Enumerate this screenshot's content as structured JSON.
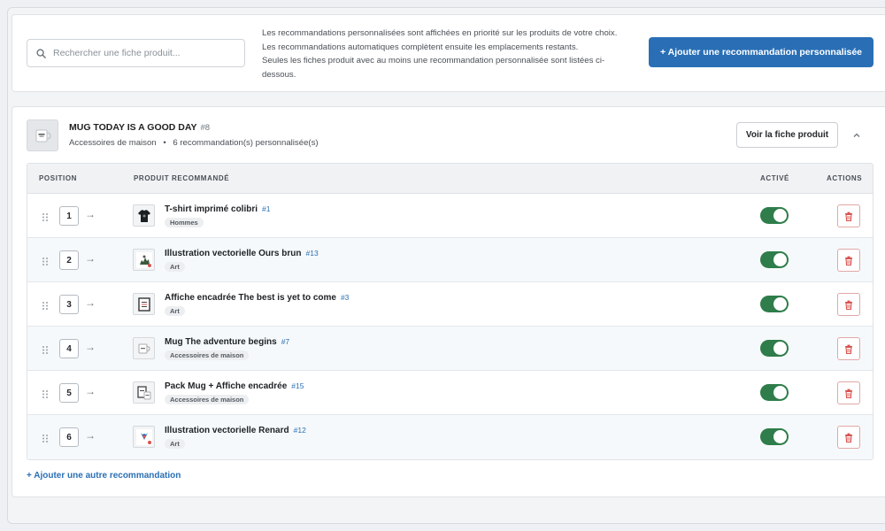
{
  "header": {
    "search_placeholder": "Rechercher une fiche produit...",
    "info_lines": [
      "Les recommandations personnalisées sont affichées en priorité sur les produits de votre choix.",
      "Les recommandations automatiques complètent ensuite les emplacements restants.",
      "Seules les fiches produit avec au moins une recommandation personnalisée sont listées ci-dessous."
    ],
    "add_button": "+ Ajouter une recommandation personnalisée"
  },
  "product": {
    "title": "MUG TODAY IS A GOOD DAY",
    "id": "#8",
    "category": "Accessoires de maison",
    "separator": "•",
    "count_text": "6 recommandation(s) personnalisée(s)",
    "view_button": "Voir la fiche produit"
  },
  "table": {
    "headers": {
      "position": "POSITION",
      "product": "PRODUIT RECOMMANDÉ",
      "active": "ACTIVÉ",
      "actions": "ACTIONS"
    },
    "rows": [
      {
        "position": "1",
        "name": "T-shirt imprimé colibri",
        "id": "#1",
        "category": "Hommes",
        "active": true,
        "thumb": "tshirt"
      },
      {
        "position": "2",
        "name": "Illustration vectorielle Ours brun",
        "id": "#13",
        "category": "Art",
        "active": true,
        "thumb": "bear"
      },
      {
        "position": "3",
        "name": "Affiche encadrée The best is yet to come",
        "id": "#3",
        "category": "Art",
        "active": true,
        "thumb": "frame"
      },
      {
        "position": "4",
        "name": "Mug The adventure begins",
        "id": "#7",
        "category": "Accessoires de maison",
        "active": true,
        "thumb": "mug"
      },
      {
        "position": "5",
        "name": "Pack Mug + Affiche encadrée",
        "id": "#15",
        "category": "Accessoires de maison",
        "active": true,
        "thumb": "pack"
      },
      {
        "position": "6",
        "name": "Illustration vectorielle Renard",
        "id": "#12",
        "category": "Art",
        "active": true,
        "thumb": "fox"
      }
    ]
  },
  "add_another": "+ Ajouter une autre recommandation",
  "colors": {
    "primary": "#2a6fb5",
    "toggle_on": "#2e7d4a",
    "delete": "#d9534f"
  },
  "icons": {
    "search": "search-icon",
    "drag": "drag-handle-icon",
    "arrow": "arrow-right-icon",
    "collapse": "chevron-up-icon",
    "delete": "trash-icon"
  }
}
